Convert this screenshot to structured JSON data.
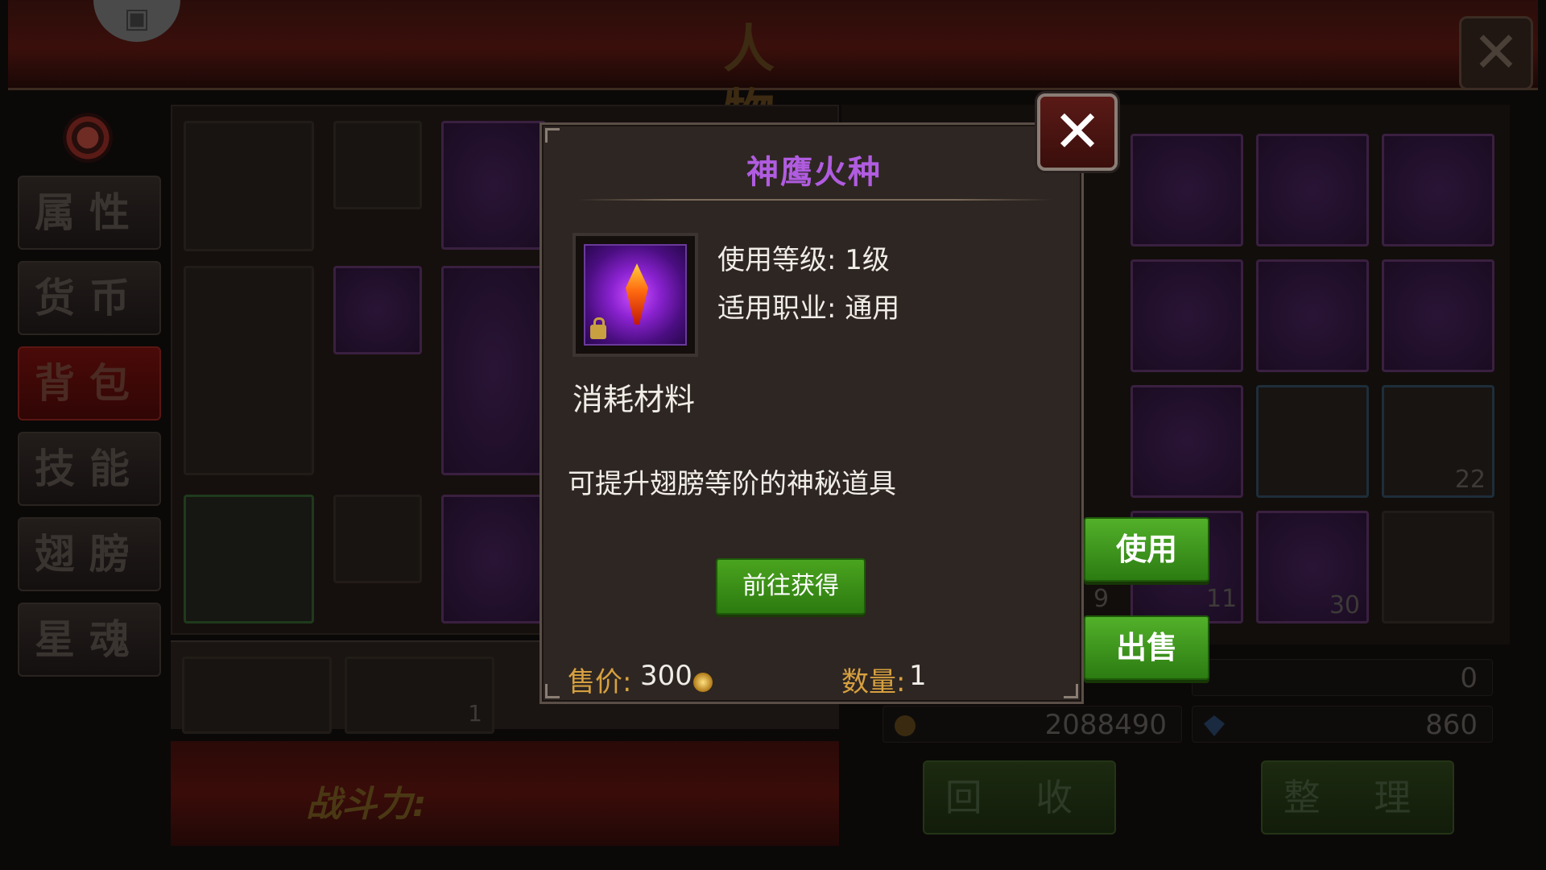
{
  "background": {
    "screen_title": "人 物",
    "tabs": [
      "属性",
      "货币",
      "背包",
      "技能",
      "翅膀",
      "星魂"
    ],
    "active_tab": "背包",
    "power_label": "战斗力:",
    "equip_counts": [
      "1"
    ],
    "bag_counts": [
      "22",
      "9",
      "11",
      "30"
    ],
    "resources": {
      "gold": "2088490",
      "diamond": "860",
      "top_right_value": "0"
    },
    "recycle_button": "回 收",
    "sort_button": "整 理"
  },
  "popup": {
    "item_name": "神鹰火种",
    "use_level_label": "使用等级: 1级",
    "class_label": "适用职业: 通用",
    "category": "消耗材料",
    "description": "可提升翅膀等阶的神秘道具",
    "goto_button": "前往获得",
    "price_label": "售价:",
    "price_value": "300",
    "quantity_label": "数量:",
    "quantity_value": "1",
    "title_color": "#b05ce0"
  },
  "actions": {
    "use_button": "使用",
    "sell_button": "出售"
  },
  "icons": {
    "close": "close-icon",
    "coin": "coin-icon",
    "lock": "lock-icon",
    "item": "flame-crystal-icon"
  }
}
